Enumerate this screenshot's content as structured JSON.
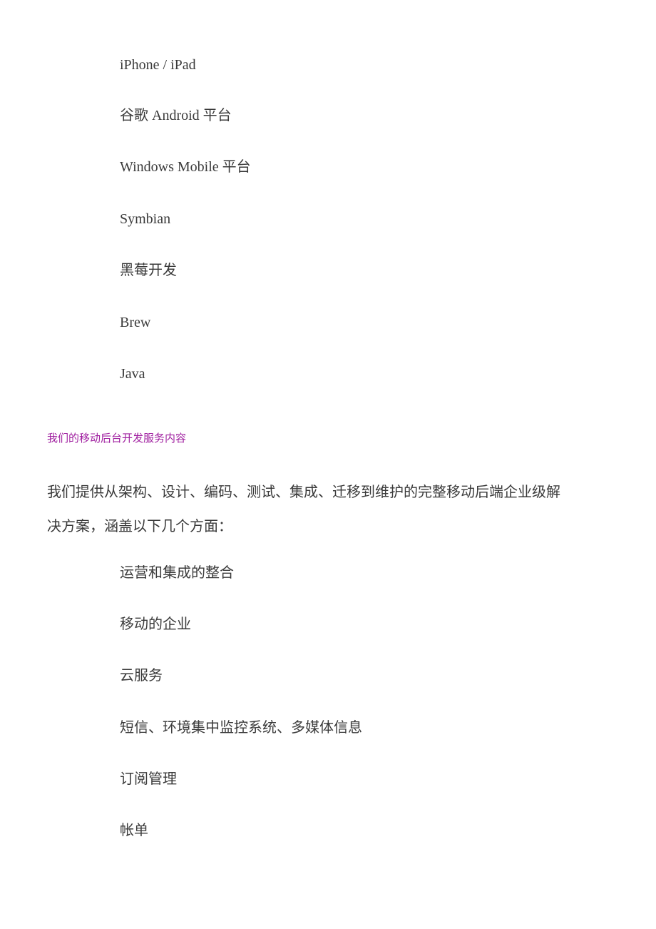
{
  "platforms": [
    "iPhone / iPad",
    "谷歌 Android 平台",
    "Windows Mobile 平台",
    "Symbian",
    "黑莓开发",
    "Brew",
    "Java"
  ],
  "section": {
    "heading": "我们的移动后台开发服务内容",
    "intro_line1": "我们提供从架构、设计、编码、测试、集成、迁移到维护的完整移动后端企业级解",
    "intro_line2": "决方案，涵盖以下几个方面：",
    "items": [
      "运营和集成的整合",
      "移动的企业",
      "云服务",
      "短信、环境集中监控系统、多媒体信息",
      "订阅管理",
      "帐单"
    ]
  },
  "colors": {
    "text": "#3a3a3a",
    "heading": "#a020a0"
  }
}
